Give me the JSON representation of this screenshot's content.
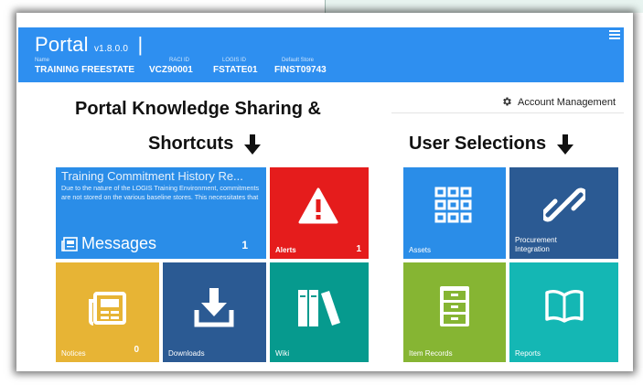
{
  "header": {
    "brand": "Portal",
    "version": "v1.8.0.0",
    "fields": [
      {
        "label": "Name",
        "value": "TRAINING FREESTATE"
      },
      {
        "label": "RACI ID",
        "value": "VCZ90001"
      },
      {
        "label": "LOGIS ID",
        "value": "FSTATE01"
      },
      {
        "label": "Default Store",
        "value": "FINST09743"
      }
    ]
  },
  "account": {
    "label": "Account Management"
  },
  "sections": {
    "knowledge_line1": "Portal Knowledge Sharing &",
    "knowledge_line2": "Shortcuts",
    "user": "User Selections"
  },
  "tiles": {
    "messages": {
      "title": "Training Commitment History Re...",
      "body": "Due to the nature of the LOGIS Training Environment, commitments are not stored on the various baseline stores. This necessitates that",
      "label": "Messages",
      "count": "1"
    },
    "alerts": {
      "label": "Alerts",
      "count": "1"
    },
    "notices": {
      "label": "Notices",
      "count": "0"
    },
    "downloads": {
      "label": "Downloads"
    },
    "wiki": {
      "label": "Wiki"
    },
    "assets": {
      "label": "Assets"
    },
    "procurement": {
      "label": "Procurement Integration"
    },
    "item_records": {
      "label": "Item Records"
    },
    "reports": {
      "label": "Reports"
    }
  },
  "colors": {
    "header": "#2e8ff0",
    "messages": "#2a8de8",
    "alerts": "#e51c1c",
    "notices": "#e7b435",
    "downloads": "#2b5a93",
    "wiki": "#069a8e",
    "assets": "#2a8de8",
    "procurement": "#2b5a93",
    "item_records": "#86b533",
    "reports": "#14b7b4"
  }
}
